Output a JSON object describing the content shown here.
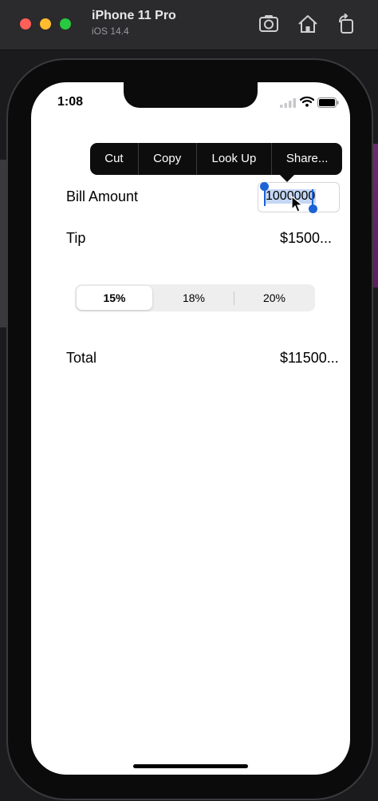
{
  "window": {
    "title": "iPhone 11 Pro",
    "subtitle": "iOS 14.4",
    "toolbar_icons": [
      "screenshot-icon",
      "home-icon",
      "rotate-icon"
    ]
  },
  "status_bar": {
    "time": "1:08",
    "icons": [
      "cellular-signal-icon",
      "wifi-icon",
      "battery-icon"
    ]
  },
  "edit_menu": {
    "items": [
      "Cut",
      "Copy",
      "Look Up",
      "Share..."
    ]
  },
  "form": {
    "bill_label": "Bill Amount",
    "bill_value": "1000000",
    "tip_label": "Tip",
    "tip_value": "$1500...",
    "total_label": "Total",
    "total_value": "$11500..."
  },
  "tip_percentages": {
    "options": [
      "15%",
      "18%",
      "20%"
    ],
    "selected": "15%"
  },
  "colors": {
    "selection_handle": "#1b63d6",
    "selection_highlight": "#c4d6f4"
  }
}
